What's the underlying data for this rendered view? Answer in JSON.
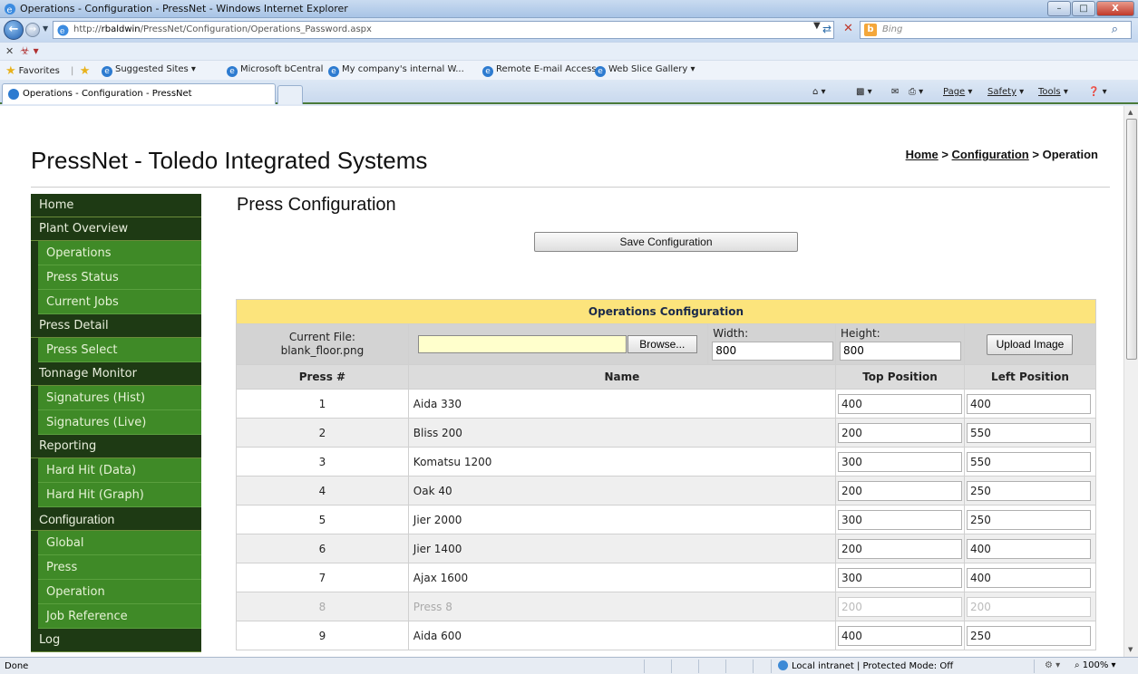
{
  "window": {
    "title": "Operations - Configuration - PressNet - Windows Internet Explorer",
    "minimize": "–",
    "maximize": "□",
    "close": "X"
  },
  "address": {
    "url_prefix": "http://",
    "url_host": "rbaldwin",
    "url_path": "/PressNet/Configuration/Operations_Password.aspx",
    "search_placeholder": "Bing"
  },
  "favorites": {
    "label": "Favorites",
    "items": [
      "Suggested Sites ▾",
      "Microsoft bCentral",
      "My company's internal W...",
      "Remote E-mail Access",
      "Web Slice Gallery ▾"
    ]
  },
  "tab": {
    "label": "Operations - Configuration - PressNet"
  },
  "commands": {
    "page": "Page",
    "safety": "Safety",
    "tools": "Tools"
  },
  "site": {
    "title": "PressNet - Toledo Integrated Systems",
    "breadcrumb": {
      "home": "Home",
      "sep1": " > ",
      "config": "Configuration",
      "sep2": " > ",
      "current": "Operation"
    }
  },
  "nav": {
    "home": "Home",
    "plant_overview": "Plant Overview",
    "operations": "Operations",
    "press_status": "Press Status",
    "current_jobs": "Current Jobs",
    "press_detail": "Press Detail",
    "press_select": "Press Select",
    "tonnage_monitor": "Tonnage Monitor",
    "signatures_hist": "Signatures (Hist)",
    "signatures_live": "Signatures (Live)",
    "reporting": "Reporting",
    "hard_hit_data": "Hard Hit (Data)",
    "hard_hit_graph": "Hard Hit (Graph)",
    "configuration": "Configuration",
    "global": "Global",
    "press": "Press",
    "operation": "Operation",
    "job_reference": "Job Reference",
    "log": "Log"
  },
  "main": {
    "heading": "Press Configuration",
    "save_button": "Save Configuration",
    "table_caption": "Operations Configuration",
    "current_file_label": "Current File:",
    "current_file_value": "blank_floor.png",
    "browse_button": "Browse...",
    "width_label": "Width:",
    "width_value": "800",
    "height_label": "Height:",
    "height_value": "800",
    "upload_button": "Upload Image",
    "columns": {
      "press": "Press #",
      "name": "Name",
      "top": "Top Position",
      "left": "Left Position"
    },
    "rows": [
      {
        "num": "1",
        "name": "Aida 330",
        "top": "400",
        "left": "400",
        "enabled": true
      },
      {
        "num": "2",
        "name": "Bliss 200",
        "top": "200",
        "left": "550",
        "enabled": true
      },
      {
        "num": "3",
        "name": "Komatsu 1200",
        "top": "300",
        "left": "550",
        "enabled": true
      },
      {
        "num": "4",
        "name": "Oak 40",
        "top": "200",
        "left": "250",
        "enabled": true
      },
      {
        "num": "5",
        "name": "Jier 2000",
        "top": "300",
        "left": "250",
        "enabled": true
      },
      {
        "num": "6",
        "name": "Jier 1400",
        "top": "200",
        "left": "400",
        "enabled": true
      },
      {
        "num": "7",
        "name": "Ajax 1600",
        "top": "300",
        "left": "400",
        "enabled": true
      },
      {
        "num": "8",
        "name": "Press 8",
        "top": "200",
        "left": "200",
        "enabled": false
      },
      {
        "num": "9",
        "name": "Aida 600",
        "top": "400",
        "left": "250",
        "enabled": true
      }
    ]
  },
  "status": {
    "left": "Done",
    "zone": "Local intranet | Protected Mode: Off",
    "zoom": "100%"
  }
}
